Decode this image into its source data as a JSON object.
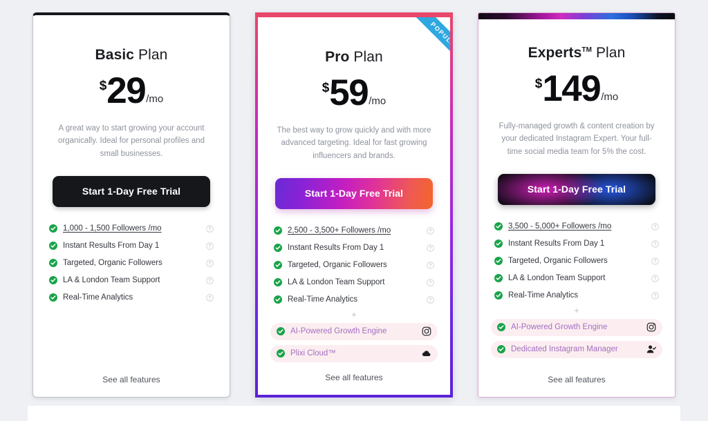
{
  "page": {
    "background_color": "#eef0f4",
    "bottom_strip_color": "#ffffff"
  },
  "plans": [
    {
      "id": "basic",
      "title_bold": "Basic",
      "title_rest": "Plan",
      "trademark": "",
      "currency": "$",
      "amount": "29",
      "period": "/mo",
      "description": "A great way to start growing your account organically. Ideal for personal profiles and small businesses.",
      "cta_label": "Start 1-Day Free Trial",
      "cta_style": "dark",
      "ribbon": null,
      "features": [
        {
          "label": "1,000 - 1,500 Followers /mo",
          "underlined": true,
          "help": true
        },
        {
          "label": "Instant Results From Day 1",
          "underlined": false,
          "help": true
        },
        {
          "label": "Targeted, Organic Followers",
          "underlined": false,
          "help": true
        },
        {
          "label": "LA & London Team Support",
          "underlined": false,
          "help": true
        },
        {
          "label": "Real-Time Analytics",
          "underlined": false,
          "help": true
        }
      ],
      "plus_separator": "",
      "bonus_features": [],
      "see_all_label": "See all features",
      "accent_color": "#16181c"
    },
    {
      "id": "pro",
      "title_bold": "Pro",
      "title_rest": "Plan",
      "trademark": "",
      "currency": "$",
      "amount": "59",
      "period": "/mo",
      "description": "The best way to grow quickly and with more advanced targeting. Ideal for fast growing influencers and brands.",
      "cta_label": "Start 1-Day Free Trial",
      "cta_style": "gradient",
      "ribbon": "POPULAR",
      "features": [
        {
          "label": "2,500 - 3,500+ Followers /mo",
          "underlined": true,
          "help": true
        },
        {
          "label": "Instant Results From Day 1",
          "underlined": false,
          "help": true
        },
        {
          "label": "Targeted, Organic Followers",
          "underlined": false,
          "help": true
        },
        {
          "label": "LA & London Team Support",
          "underlined": false,
          "help": true
        },
        {
          "label": "Real-Time Analytics",
          "underlined": false,
          "help": true
        }
      ],
      "plus_separator": "+",
      "bonus_features": [
        {
          "label": "AI-Powered Growth Engine",
          "icon": "instagram-icon"
        },
        {
          "label": "Plixi Cloud™",
          "icon": "cloud-icon"
        }
      ],
      "see_all_label": "See all features",
      "accent_color": "#f4662a"
    },
    {
      "id": "experts",
      "title_bold": "Experts",
      "title_rest": "Plan",
      "trademark": "TM",
      "currency": "$",
      "amount": "149",
      "period": "/mo",
      "description": "Fully-managed growth & content creation by your dedicated Instagram Expert. Your full-time social media team for 5% the cost.",
      "cta_label": "Start 1-Day Free Trial",
      "cta_style": "glow",
      "ribbon": null,
      "features": [
        {
          "label": "3,500 - 5,000+ Followers /mo",
          "underlined": true,
          "help": true
        },
        {
          "label": "Instant Results From Day 1",
          "underlined": false,
          "help": true
        },
        {
          "label": "Targeted, Organic Followers",
          "underlined": false,
          "help": true
        },
        {
          "label": "LA & London Team Support",
          "underlined": false,
          "help": true
        },
        {
          "label": "Real-Time Analytics",
          "underlined": false,
          "help": true
        }
      ],
      "plus_separator": "+",
      "bonus_features": [
        {
          "label": "AI-Powered Growth Engine",
          "icon": "instagram-icon"
        },
        {
          "label": "Dedicated Instagram Manager",
          "icon": "person-check-icon"
        }
      ],
      "see_all_label": "See all features",
      "accent_color": "#cf29bf"
    }
  ],
  "colors": {
    "check_green": "#1aa34a",
    "bonus_text": "#a36ec2",
    "bonus_background": "#fceef0",
    "ribbon_blue": "#2fa8e0",
    "description_grey": "#8d929c"
  }
}
